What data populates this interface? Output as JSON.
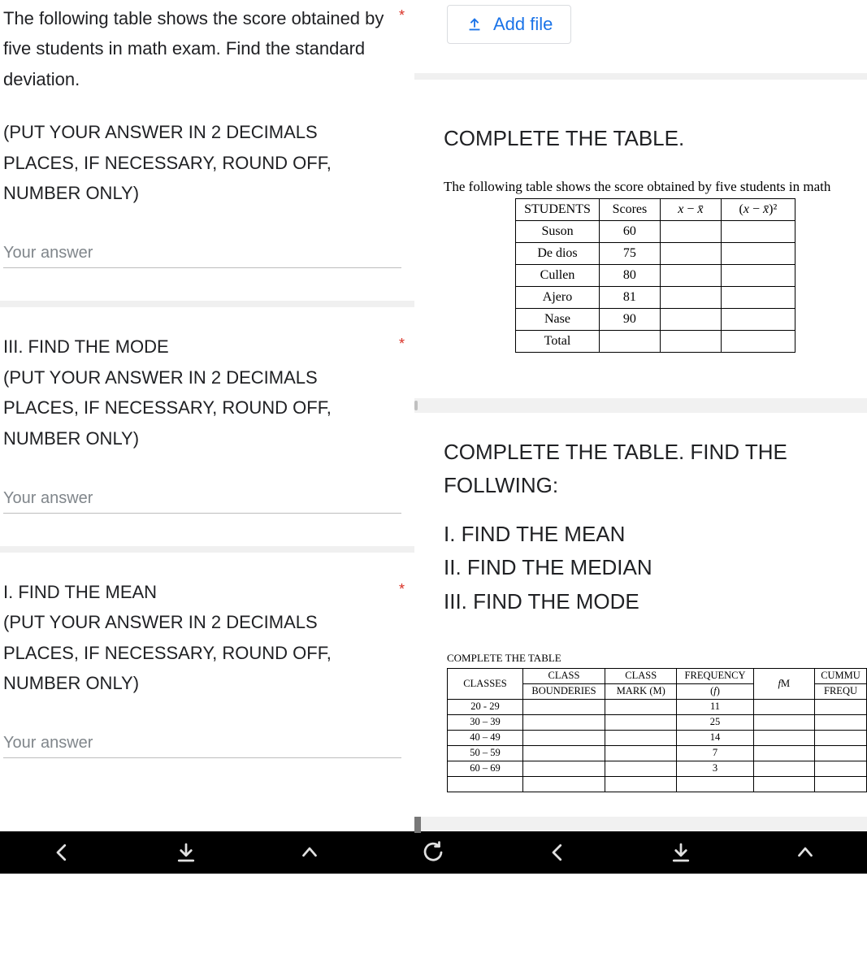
{
  "left": {
    "q1": {
      "intro": "The following table shows the score obtained by five students in math exam. Find the standard deviation.",
      "instr": "(PUT YOUR ANSWER IN 2 DECIMALS PLACES, IF NECESSARY, ROUND OFF, NUMBER ONLY)",
      "placeholder": "Your answer"
    },
    "q2": {
      "title": "III. FIND THE MODE",
      "instr": "(PUT YOUR ANSWER IN 2 DECIMALS PLACES, IF NECESSARY, ROUND OFF, NUMBER ONLY)",
      "placeholder": "Your answer"
    },
    "q3": {
      "title": "I. FIND THE MEAN",
      "instr": "(PUT YOUR ANSWER IN 2 DECIMALS PLACES, IF NECESSARY, ROUND OFF, NUMBER ONLY)",
      "placeholder": "Your answer"
    }
  },
  "right": {
    "add_file": "Add file",
    "title1": "COMPLETE THE TABLE.",
    "caption1": "The following table shows the score obtained by five students in math ",
    "score_table": {
      "headers": {
        "c0": "STUDENTS",
        "c1": "Scores",
        "c2_html": "x − x̄",
        "c3_html": "(x − x̄)²"
      },
      "rows": [
        {
          "name": "Suson",
          "score": "60"
        },
        {
          "name": "De dios",
          "score": "75"
        },
        {
          "name": "Cullen",
          "score": "80"
        },
        {
          "name": "Ajero",
          "score": "81"
        },
        {
          "name": "Nase",
          "score": "90"
        },
        {
          "name": "Total",
          "score": ""
        }
      ]
    },
    "title2a": "COMPLETE THE TABLE. FIND THE FOLLWING:",
    "title2b": "I. FIND THE MEAN",
    "title2c": "II. FIND THE MEDIAN",
    "title2d": "III. FIND THE MODE",
    "small_caption": "COMPLETE THE TABLE",
    "freq_table": {
      "headers": {
        "c0": "CLASSES",
        "c1a": "CLASS",
        "c1b": "BOUNDERIES",
        "c2a": "CLASS",
        "c2b": "MARK (M)",
        "c3a": "FREQUENCY",
        "c3b": "(f)",
        "c4": "fM",
        "c5a": "CUMMU",
        "c5b": "FREQU"
      },
      "rows": [
        {
          "cls": "20 - 29",
          "freq": "11"
        },
        {
          "cls": "30 – 39",
          "freq": "25"
        },
        {
          "cls": "40 – 49",
          "freq": "14"
        },
        {
          "cls": "50 – 59",
          "freq": "7"
        },
        {
          "cls": "60 – 69",
          "freq": "3"
        },
        {
          "cls": "",
          "freq": ""
        }
      ]
    }
  },
  "chart_data": [
    {
      "type": "table",
      "title": "Scores obtained by five students in math exam",
      "columns": [
        "STUDENTS",
        "Scores",
        "x − x̄",
        "(x − x̄)²"
      ],
      "rows": [
        [
          "Suson",
          60,
          null,
          null
        ],
        [
          "De dios",
          75,
          null,
          null
        ],
        [
          "Cullen",
          80,
          null,
          null
        ],
        [
          "Ajero",
          81,
          null,
          null
        ],
        [
          "Nase",
          90,
          null,
          null
        ],
        [
          "Total",
          null,
          null,
          null
        ]
      ]
    },
    {
      "type": "table",
      "title": "COMPLETE THE TABLE",
      "columns": [
        "CLASSES",
        "CLASS BOUNDERIES",
        "CLASS MARK (M)",
        "FREQUENCY (f)",
        "fM",
        "CUMMULATIVE FREQUENCY"
      ],
      "rows": [
        [
          "20 - 29",
          null,
          null,
          11,
          null,
          null
        ],
        [
          "30 – 39",
          null,
          null,
          25,
          null,
          null
        ],
        [
          "40 – 49",
          null,
          null,
          14,
          null,
          null
        ],
        [
          "50 – 59",
          null,
          null,
          7,
          null,
          null
        ],
        [
          "60 – 69",
          null,
          null,
          3,
          null,
          null
        ]
      ]
    }
  ]
}
